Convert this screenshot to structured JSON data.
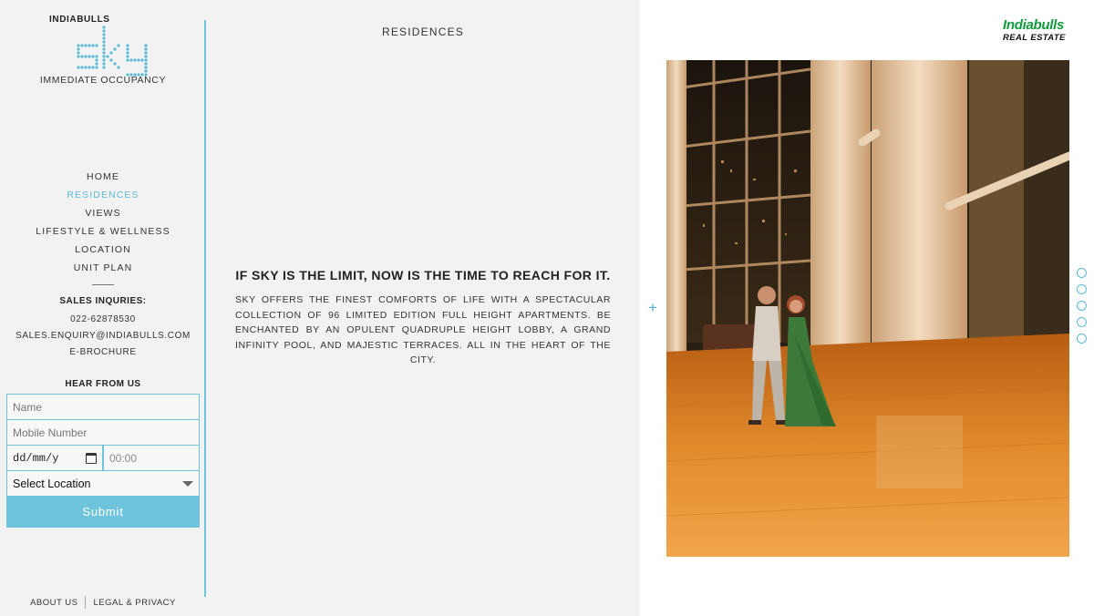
{
  "logo": {
    "brand": "INDIABULLS",
    "word": "sky",
    "tagline": "IMMEDIATE OCCUPANCY"
  },
  "nav": {
    "items": [
      {
        "label": "HOME",
        "active": false
      },
      {
        "label": "RESIDENCES",
        "active": true
      },
      {
        "label": "VIEWS",
        "active": false
      },
      {
        "label": "LIFESTYLE & WELLNESS",
        "active": false
      },
      {
        "label": "LOCATION",
        "active": false
      },
      {
        "label": "UNIT PLAN",
        "active": false
      }
    ]
  },
  "sales": {
    "title": "SALES INQURIES:",
    "phone": "022-62878530",
    "email": "SALES.ENQUIRY@INDIABULLS.COM",
    "brochure": "E-BROCHURE"
  },
  "form": {
    "title": "HEAR FROM US",
    "name_placeholder": "Name",
    "mobile_placeholder": "Mobile Number",
    "date_value": "dd/mm/y",
    "time_value": "00:00",
    "location_value": "Select Location",
    "submit_label": "Submit"
  },
  "footer": {
    "about": "ABOUT US",
    "legal": "LEGAL & PRIVACY"
  },
  "content": {
    "section_title": "RESIDENCES",
    "headline": "IF SKY IS THE LIMIT, NOW IS THE TIME TO REACH FOR IT.",
    "body": "SKY OFFERS THE FINEST COMFORTS OF LIFE WITH A SPECTACULAR COLLECTION OF 96 LIMITED EDITION FULL HEIGHT APARTMENTS. BE ENCHANTED BY AN OPULENT QUADRUPLE HEIGHT LOBBY, A GRAND INFINITY POOL, AND MAJESTIC TERRACES. ALL IN THE HEART OF THE CITY."
  },
  "right_panel": {
    "brand_top": "Indiabulls",
    "brand_bottom": "REAL ESTATE",
    "expand_icon": "plus-icon",
    "slide_count": 5,
    "active_slide": null
  },
  "colors": {
    "accent": "#6ec4dc",
    "active_nav": "#5bbad5",
    "brand_green": "#0f9b3e",
    "background": "#f3f2f2"
  }
}
